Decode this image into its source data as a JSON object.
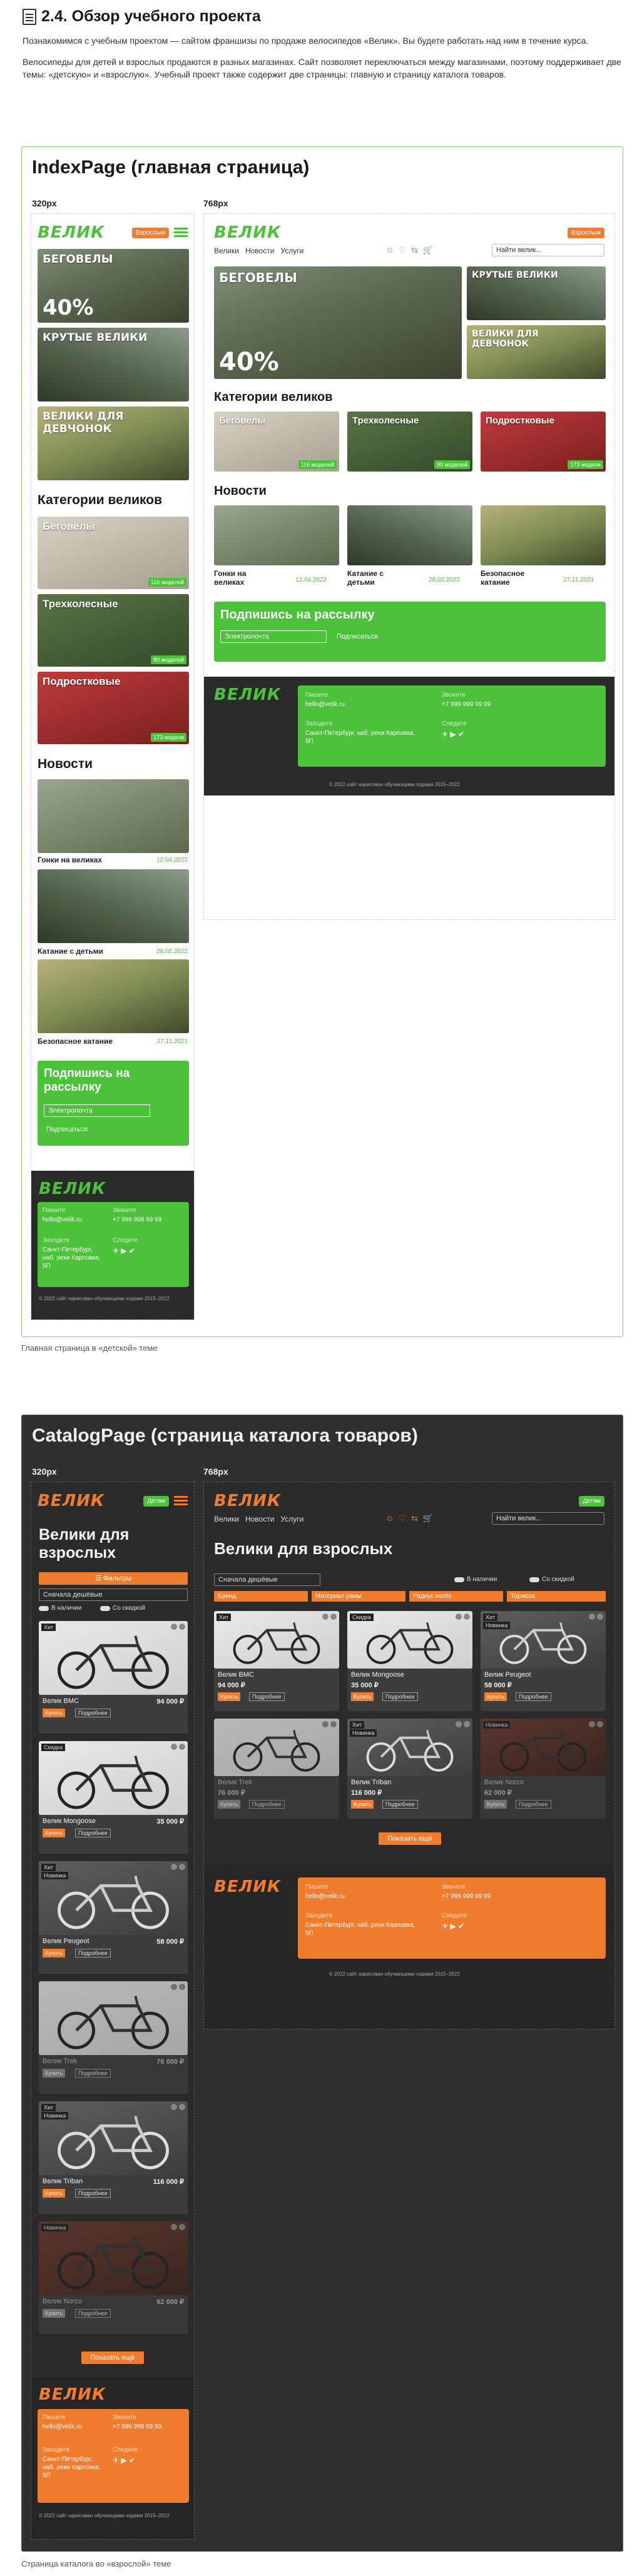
{
  "doc": {
    "title": "2.4. Обзор учебного проекта",
    "p1": "Познакомимся с учебным проектом — сайтом франшизы по продаже велосипедов «Велик». Вы будете работать над ним в течение курса.",
    "p2": "Велосипеды для детей и взрослых продаются в разных магазинах. Сайт позволяет переключаться между магазинами, поэтому поддерживает две темы: «детскую» и «взрослую». Учебный проект также содержит две страницы: главную и страницу каталога товаров."
  },
  "index": {
    "title": "IndexPage (главная страница)",
    "bp320": "320px",
    "bp768": "768px",
    "caption": "Главная страница в «детской» теме"
  },
  "catalog": {
    "title": "CatalogPage (страница каталога товаров)",
    "bp320": "320px",
    "bp768": "768px",
    "caption": "Страница каталога во «взрослой» теме"
  },
  "site": {
    "logo": "ВЕЛИК",
    "theme_adult": "Взрослым",
    "theme_kids": "Детям",
    "nav": [
      "Велики",
      "Новости",
      "Услуги"
    ],
    "search_placeholder": "Найти велик...",
    "banners": [
      "БЕГОВЕЛЫ",
      "КРУТЫЕ ВЕЛИКИ",
      "ВЕЛИКИ ДЛЯ ДЕВЧОНОК"
    ],
    "banner_discount": "40%",
    "categories_title": "Категории великов",
    "categories": [
      {
        "name": "Беговелы",
        "count": "116 моделей"
      },
      {
        "name": "Трехколесные",
        "count": "80 моделей"
      },
      {
        "name": "Подростковые",
        "count": "173 модели"
      }
    ],
    "news_title": "Новости",
    "news": [
      {
        "title": "Гонки на великах",
        "date": "12.04.2022"
      },
      {
        "title": "Катание с детьми",
        "date": "28.02.2022"
      },
      {
        "title": "Безопасное катание",
        "date": "27.11.2021"
      }
    ],
    "subscribe_title": "Подпишись на рассылку",
    "subscribe_placeholder": "Электропочта",
    "subscribe_button": "Подписаться",
    "footer": {
      "mail_label": "Пишите",
      "mail": "hello@velik.ru",
      "phone_label": "Звоните",
      "phone": "+7 999 999 99 99",
      "address_label": "Заходите",
      "address": "Санкт-Петербург, наб. реки Карповка, 5П",
      "social_label": "Следите",
      "copyright": "© 2022 сайт нарисован обучающими ходами 2015–2022"
    }
  },
  "catalog_page": {
    "heading": "Велики для взрослых",
    "filters_button": "Фильтры",
    "sort": "Сначала дешёвые",
    "in_stock": "В наличии",
    "with_discount": "Со скидкой",
    "filter_tabs": [
      "Бренд",
      "Материал рамы",
      "Радиус колёс",
      "Тормоза"
    ],
    "buy": "Купить",
    "more": "Подробнее",
    "show_more": "Показать ещё",
    "products": [
      {
        "name": "Велик BMC",
        "price": "94 000 ₽",
        "tags": [
          "Хит"
        ],
        "available": true
      },
      {
        "name": "Велик Mongoose",
        "price": "35 000 ₽",
        "tags": [
          "Скидка"
        ],
        "available": true
      },
      {
        "name": "Велик Peugeot",
        "price": "58 000 ₽",
        "tags": [
          "Хит",
          "Новинка"
        ],
        "available": true
      },
      {
        "name": "Велик Trek",
        "price": "76 000 ₽",
        "tags": [],
        "available": false
      },
      {
        "name": "Велик Triban",
        "price": "116 000 ₽",
        "tags": [
          "Хит",
          "Новинка"
        ],
        "available": true
      },
      {
        "name": "Велик Norco",
        "price": "62 000 ₽",
        "tags": [
          "Новинка"
        ],
        "available": false
      }
    ]
  },
  "colors": {
    "kids_accent": "#4cc13a",
    "adult_accent": "#f07c2e",
    "dark_bg": "#2f2f2f"
  }
}
